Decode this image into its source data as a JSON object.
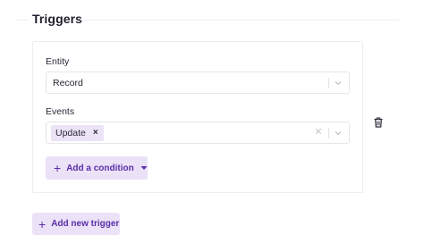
{
  "section": {
    "title": "Triggers"
  },
  "trigger": {
    "entity": {
      "label": "Entity",
      "value": "Record"
    },
    "events": {
      "label": "Events",
      "tags": [
        "Update"
      ]
    },
    "add_condition_label": "Add a condition"
  },
  "add_trigger_label": "Add new trigger",
  "colors": {
    "accent": "#5a2ea6",
    "button_bg": "#ebe2f8",
    "tag_bg": "#ebe4f7",
    "border": "#e6e6ec"
  },
  "icons": {
    "chevron": "chevron-down-icon",
    "clear": "clear-icon",
    "delete": "trash-icon",
    "add": "plus-icon",
    "caret": "caret-down-icon"
  }
}
